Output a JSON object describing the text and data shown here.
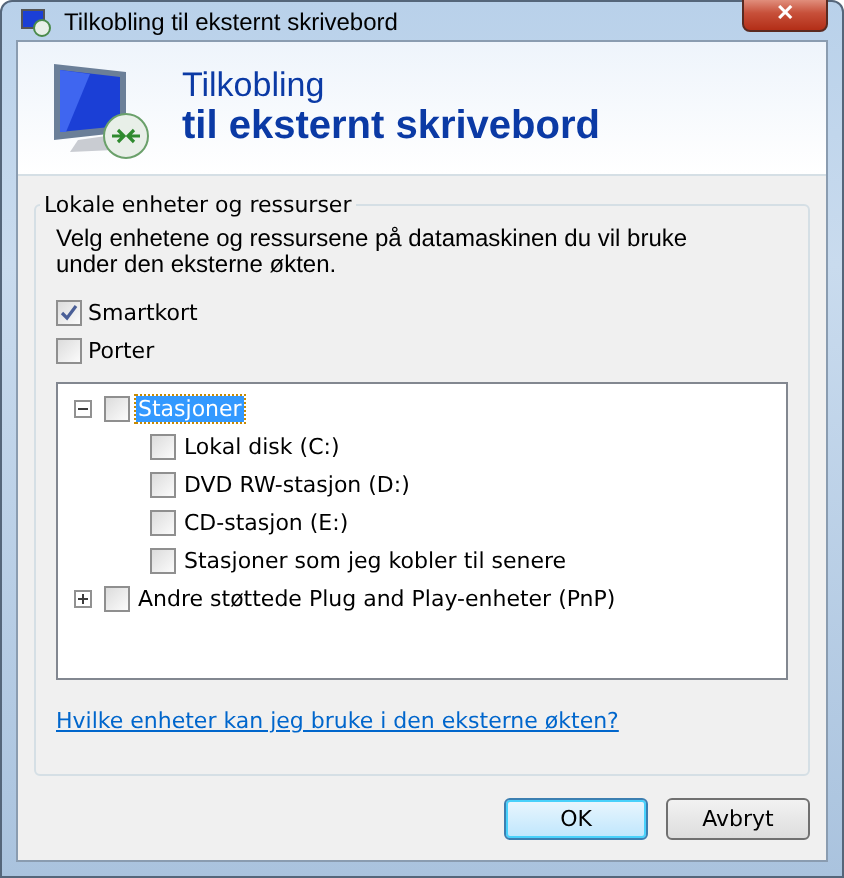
{
  "window": {
    "title": "Tilkobling til eksternt skrivebord",
    "close": "✕"
  },
  "header": {
    "line1": "Tilkobling",
    "line2": "til eksternt skrivebord"
  },
  "group": {
    "legend": "Lokale enheter og ressurser",
    "description": "Velg enhetene og ressursene på datamaskinen du vil bruke under den eksterne økten."
  },
  "options": [
    {
      "label": "Smartkort",
      "checked": true
    },
    {
      "label": "Porter",
      "checked": false
    }
  ],
  "tree": [
    {
      "label": "Stasjoner",
      "checked": false,
      "selected": true,
      "expanded": true,
      "children": [
        {
          "label": "Lokal disk (C:)",
          "checked": false,
          "selected": false
        },
        {
          "label": "DVD RW-stasjon (D:)",
          "checked": false,
          "selected": false
        },
        {
          "label": "CD-stasjon (E:)",
          "checked": false,
          "selected": false
        },
        {
          "label": "Stasjoner som jeg kobler til senere",
          "checked": false,
          "selected": false
        }
      ]
    },
    {
      "label": "Andre støttede Plug and Play-enheter (PnP)",
      "checked": false,
      "selected": false,
      "expanded": false
    }
  ],
  "link": "Hvilke enheter kan jeg bruke i den eksterne økten?",
  "buttons": [
    {
      "label": "OK",
      "kind": "default"
    },
    {
      "label": "Avbryt",
      "kind": "normal"
    }
  ]
}
